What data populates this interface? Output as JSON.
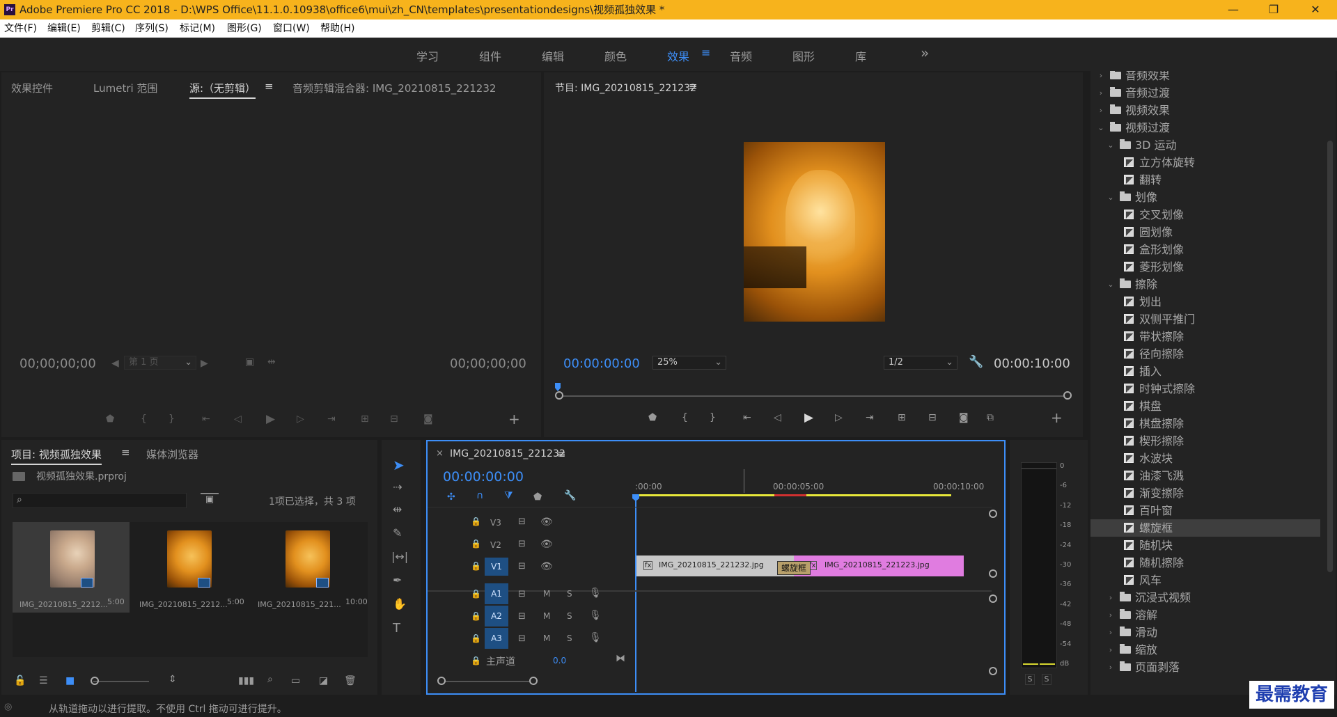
{
  "titlebar": {
    "app_icon": "Pr",
    "title": "Adobe Premiere Pro CC 2018 - D:\\WPS Office\\11.1.0.10938\\office6\\mui\\zh_CN\\templates\\presentationdesigns\\视频孤独效果 *",
    "minimize": "—",
    "maximize": "❐",
    "close": "✕"
  },
  "menubar": {
    "items": [
      "文件(F)",
      "编辑(E)",
      "剪辑(C)",
      "序列(S)",
      "标记(M)",
      "图形(G)",
      "窗口(W)",
      "帮助(H)"
    ]
  },
  "workspaces": {
    "tabs": [
      "学习",
      "组件",
      "编辑",
      "颜色",
      "效果",
      "音频",
      "图形",
      "库"
    ],
    "active": "效果",
    "menu_icon": "≡",
    "overflow": "»"
  },
  "source_panel": {
    "tabs": [
      "效果控件",
      "Lumetri 范围",
      "源:（无剪辑）",
      "音频剪辑混合器: IMG_20210815_221232"
    ],
    "active_tab": "源:（无剪辑）",
    "menu_icon": "≡",
    "timecode_left": "00;00;00;00",
    "timecode_right": "00;00;00;00",
    "page_select": "第 1 页"
  },
  "program_panel": {
    "title": "节目: IMG_20210815_221232",
    "menu_icon": "≡",
    "timecode_current": "00:00:00:00",
    "zoom": "25%",
    "resolution": "1/2",
    "timecode_duration": "00:00:10:00"
  },
  "project_panel": {
    "tabs": [
      "项目: 视频孤独效果",
      "媒体浏览器"
    ],
    "menu_icon": "≡",
    "file": "视频孤独效果.prproj",
    "search_placeholder": "",
    "selection_info": "1项已选择，共 3 项",
    "items": [
      {
        "name": "IMG_20210815_2212...",
        "duration": "5:00"
      },
      {
        "name": "IMG_20210815_2212...",
        "duration": "5:00"
      },
      {
        "name": "IMG_20210815_221...",
        "duration": "10:00"
      }
    ]
  },
  "timeline": {
    "close": "×",
    "title": "IMG_20210815_221232",
    "menu_icon": "≡",
    "timecode": "00:00:00:00",
    "ruler": [
      ":00:00",
      "00:00:05:00",
      "00:00:10:00"
    ],
    "tracks": {
      "video": [
        "V3",
        "V2",
        "V1"
      ],
      "audio": [
        "A1",
        "A2",
        "A3"
      ],
      "master_label": "主声道",
      "master_value": "0.0",
      "mute": "M",
      "solo": "S"
    },
    "clips": [
      {
        "name": "IMG_20210815_221232.jpg",
        "fx": "fx"
      },
      {
        "name": "IMG_20210815_221223.jpg",
        "fx": "fx"
      }
    ],
    "transition": "螺旋框"
  },
  "audio_meter": {
    "scale": [
      "0",
      "-6",
      "-12",
      "-18",
      "-24",
      "-30",
      "-36",
      "-42",
      "-48",
      "-54",
      "dB"
    ],
    "solo_left": "S",
    "solo_right": "S"
  },
  "effects_tree": {
    "items": [
      {
        "label": "音频效果",
        "level": 0,
        "kind": "folder",
        "open": false
      },
      {
        "label": "音频过渡",
        "level": 0,
        "kind": "folder",
        "open": false
      },
      {
        "label": "视频效果",
        "level": 0,
        "kind": "folder",
        "open": false
      },
      {
        "label": "视频过渡",
        "level": 0,
        "kind": "folder",
        "open": true
      },
      {
        "label": "3D 运动",
        "level": 1,
        "kind": "folder",
        "open": true
      },
      {
        "label": "立方体旋转",
        "level": 2,
        "kind": "fx"
      },
      {
        "label": "翻转",
        "level": 2,
        "kind": "fx"
      },
      {
        "label": "划像",
        "level": 1,
        "kind": "folder",
        "open": true
      },
      {
        "label": "交叉划像",
        "level": 2,
        "kind": "fx"
      },
      {
        "label": "圆划像",
        "level": 2,
        "kind": "fx"
      },
      {
        "label": "盒形划像",
        "level": 2,
        "kind": "fx"
      },
      {
        "label": "菱形划像",
        "level": 2,
        "kind": "fx"
      },
      {
        "label": "擦除",
        "level": 1,
        "kind": "folder",
        "open": true
      },
      {
        "label": "划出",
        "level": 2,
        "kind": "fx"
      },
      {
        "label": "双侧平推门",
        "level": 2,
        "kind": "fx"
      },
      {
        "label": "带状擦除",
        "level": 2,
        "kind": "fx"
      },
      {
        "label": "径向擦除",
        "level": 2,
        "kind": "fx"
      },
      {
        "label": "插入",
        "level": 2,
        "kind": "fx"
      },
      {
        "label": "时钟式擦除",
        "level": 2,
        "kind": "fx"
      },
      {
        "label": "棋盘",
        "level": 2,
        "kind": "fx"
      },
      {
        "label": "棋盘擦除",
        "level": 2,
        "kind": "fx"
      },
      {
        "label": "楔形擦除",
        "level": 2,
        "kind": "fx"
      },
      {
        "label": "水波块",
        "level": 2,
        "kind": "fx"
      },
      {
        "label": "油漆飞溅",
        "level": 2,
        "kind": "fx"
      },
      {
        "label": "渐变擦除",
        "level": 2,
        "kind": "fx"
      },
      {
        "label": "百叶窗",
        "level": 2,
        "kind": "fx"
      },
      {
        "label": "螺旋框",
        "level": 2,
        "kind": "fx",
        "selected": true
      },
      {
        "label": "随机块",
        "level": 2,
        "kind": "fx"
      },
      {
        "label": "随机擦除",
        "level": 2,
        "kind": "fx"
      },
      {
        "label": "风车",
        "level": 2,
        "kind": "fx"
      },
      {
        "label": "沉浸式视频",
        "level": 1,
        "kind": "folder",
        "open": false
      },
      {
        "label": "溶解",
        "level": 1,
        "kind": "folder",
        "open": false
      },
      {
        "label": "滑动",
        "level": 1,
        "kind": "folder",
        "open": false
      },
      {
        "label": "缩放",
        "level": 1,
        "kind": "folder",
        "open": false
      },
      {
        "label": "页面剥落",
        "level": 1,
        "kind": "folder",
        "open": false
      }
    ]
  },
  "statusbar": {
    "message": "从轨道拖动以进行提取。不使用 Ctrl 拖动可进行提升。"
  },
  "watermark": "最需教育",
  "colors": {
    "accent": "#3d8ef7",
    "titlebar": "#f7b31c",
    "clip_a": "#c7c7c7",
    "clip_b": "#e07ce0",
    "work_area": "#e8e83a"
  }
}
